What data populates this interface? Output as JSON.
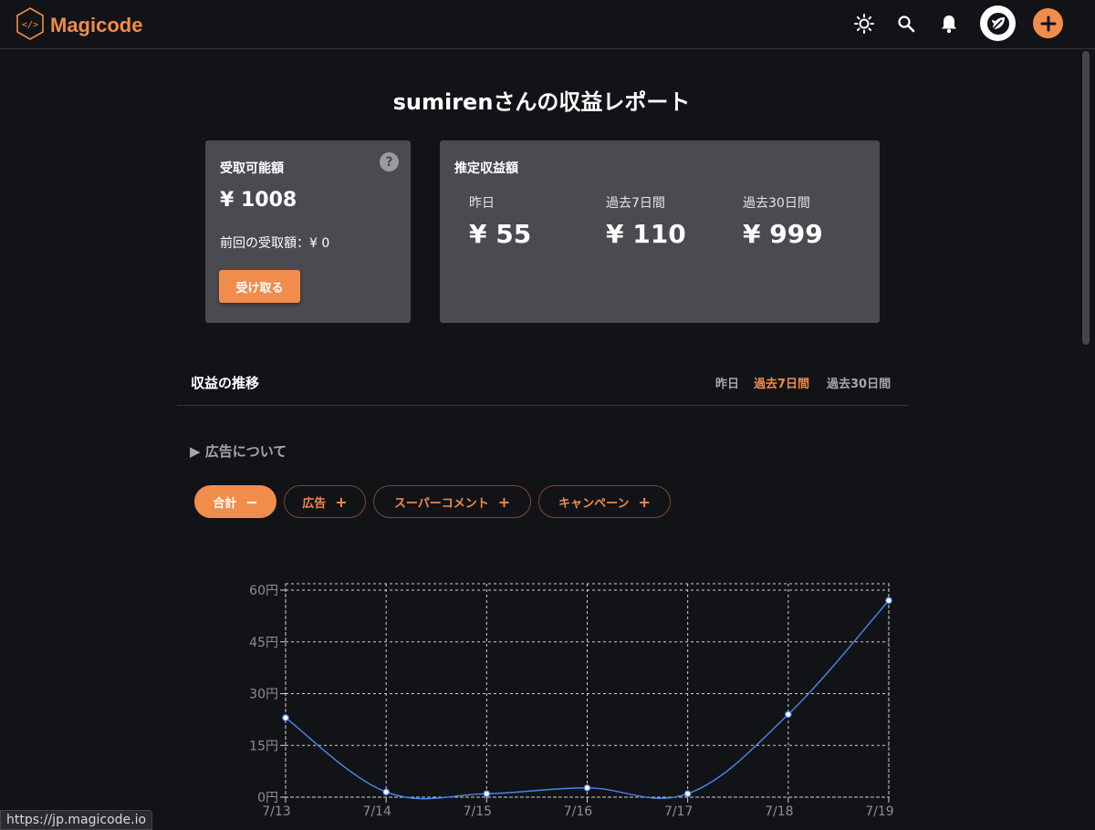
{
  "header": {
    "brand": "Magicode",
    "icons": [
      "sun-icon",
      "search-icon",
      "bell-icon",
      "avatar",
      "plus-icon"
    ]
  },
  "title": "sumirenさんの収益レポート",
  "available_card": {
    "label": "受取可能額",
    "amount": "¥ 1008",
    "previous": "前回の受取額：¥ 0",
    "button": "受け取る"
  },
  "estimate_card": {
    "label": "推定収益額",
    "periods": [
      {
        "label": "昨日",
        "value": "¥ 55"
      },
      {
        "label": "過去7日間",
        "value": "¥ 110"
      },
      {
        "label": "過去30日間",
        "value": "¥ 999"
      }
    ]
  },
  "trend": {
    "title": "収益の推移",
    "tabs": [
      {
        "label": "昨日",
        "active": false
      },
      {
        "label": "過去7日間",
        "active": true
      },
      {
        "label": "過去30日間",
        "active": false
      }
    ],
    "ad_toggle": "▶ 広告について",
    "chips": [
      {
        "label": "合計",
        "symbol": "−",
        "active": true
      },
      {
        "label": "広告",
        "symbol": "+",
        "active": false
      },
      {
        "label": "スーパーコメント",
        "symbol": "+",
        "active": false
      },
      {
        "label": "キャンペーン",
        "symbol": "+",
        "active": false
      }
    ]
  },
  "chart_data": {
    "type": "line",
    "x": [
      "7/13",
      "7/14",
      "7/15",
      "7/16",
      "7/17",
      "7/18",
      "7/19"
    ],
    "series": [
      {
        "values": [
          23,
          1.5,
          1,
          2.7,
          1,
          24,
          57
        ]
      }
    ],
    "yticks": [
      "0円",
      "15円",
      "30円",
      "45円",
      "60円"
    ],
    "ylim": [
      0,
      60
    ],
    "grid": true,
    "line_color": "#4a86f0"
  },
  "status_url": "https://jp.magicode.io"
}
